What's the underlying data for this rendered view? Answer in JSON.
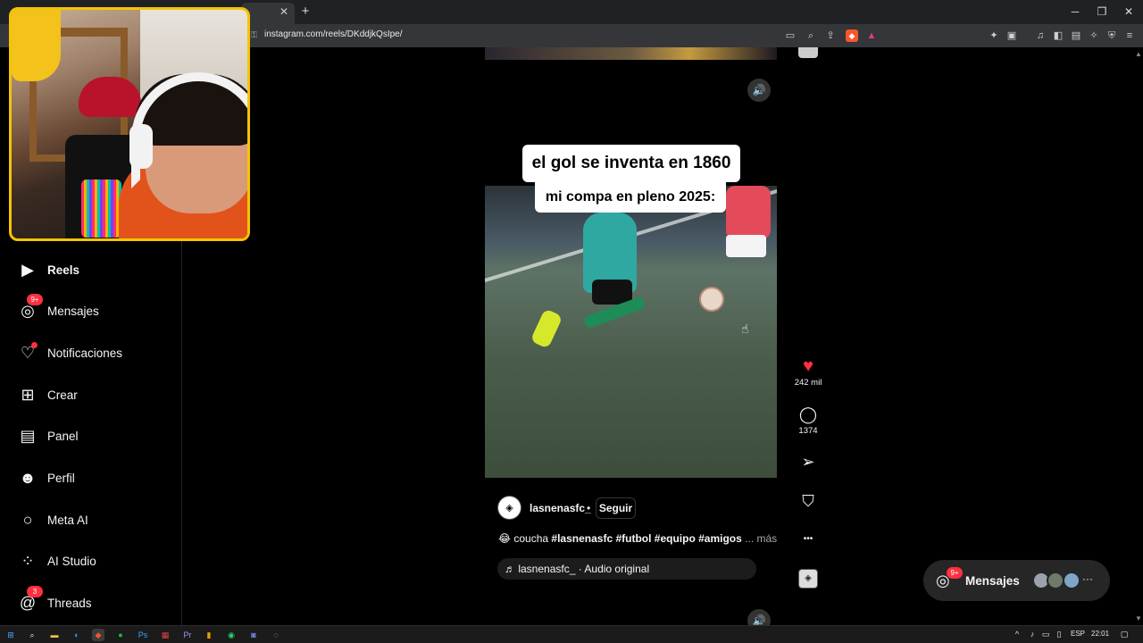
{
  "browser": {
    "url": "instagram.com/reels/DKddjkQsIpe/",
    "tab_close": "✕",
    "new_tab": "+",
    "window_buttons": [
      "─",
      "❐",
      "✕"
    ]
  },
  "sidebar": {
    "items": [
      {
        "label": "Reels",
        "icon": "reels-icon",
        "glyph": "▶"
      },
      {
        "label": "Mensajes",
        "icon": "messenger-icon",
        "glyph": "◎",
        "badge": "9+"
      },
      {
        "label": "Notificaciones",
        "icon": "heart-icon",
        "glyph": "♡"
      },
      {
        "label": "Crear",
        "icon": "plus-square-icon",
        "glyph": "⊞"
      },
      {
        "label": "Panel",
        "icon": "dashboard-icon",
        "glyph": "▤"
      },
      {
        "label": "Perfil",
        "icon": "profile-icon",
        "glyph": "☻"
      },
      {
        "label": "Meta AI",
        "icon": "meta-ai-icon",
        "glyph": "○"
      },
      {
        "label": "AI Studio",
        "icon": "ai-studio-icon",
        "glyph": "⁘"
      },
      {
        "label": "Threads",
        "icon": "threads-icon",
        "glyph": "@",
        "badge": "3"
      }
    ]
  },
  "reel": {
    "caption_line1": "el gol se inventa en 1860",
    "caption_line2": "mi compa en pleno 2025:",
    "author": "lasnenasfc_",
    "separator": "•",
    "follow_label": "Seguir",
    "caption_emoji": "😂",
    "caption_word": "coucha",
    "hashtags": "#lasnenasfc #futbol #equipo #amigos",
    "more_label": "... más",
    "audio_glyph": "♬",
    "audio_label": "lasnenasfc_ · Audio original",
    "volume_glyph": "🔊"
  },
  "actions": {
    "likes": "242 mil",
    "comments": "1374",
    "like_glyph": "♥",
    "comment_glyph": "◯",
    "share_glyph": "➢",
    "save_glyph": "⛉",
    "more_glyph": "•••"
  },
  "floating_messages": {
    "label": "Mensajes",
    "badge": "9+",
    "more": "···"
  },
  "taskbar": {
    "language": "ESP",
    "time": "22:01"
  },
  "colors": {
    "accent_red": "#ff3040",
    "webcam_border": "#f4c400",
    "background": "#000000"
  }
}
